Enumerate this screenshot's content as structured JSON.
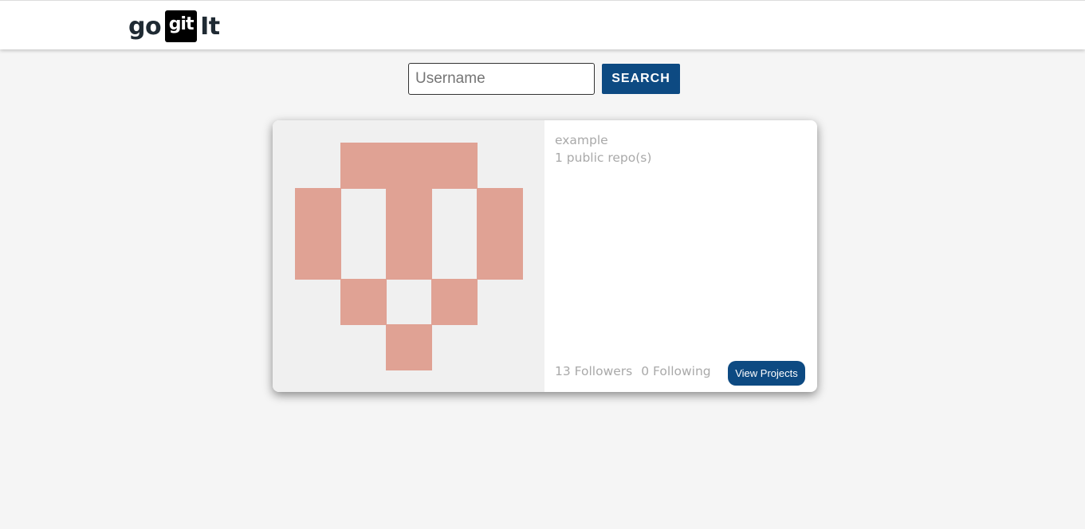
{
  "header": {
    "logo": {
      "left": "go",
      "box": "git",
      "right": "It"
    }
  },
  "search": {
    "placeholder": "Username",
    "value": "",
    "button_label": "SEARCH"
  },
  "profile_card": {
    "avatar_color": "#e0a294",
    "avatar_bg": "#f0f0f0",
    "username": "example",
    "repos": "1 public repo(s)",
    "followers": "13 Followers",
    "following": "0 Following",
    "view_button_label": "View Projects"
  },
  "colors": {
    "accent": "#0d4a82",
    "page_bg": "#f5f5f5",
    "muted_text": "#a9a9a9"
  }
}
